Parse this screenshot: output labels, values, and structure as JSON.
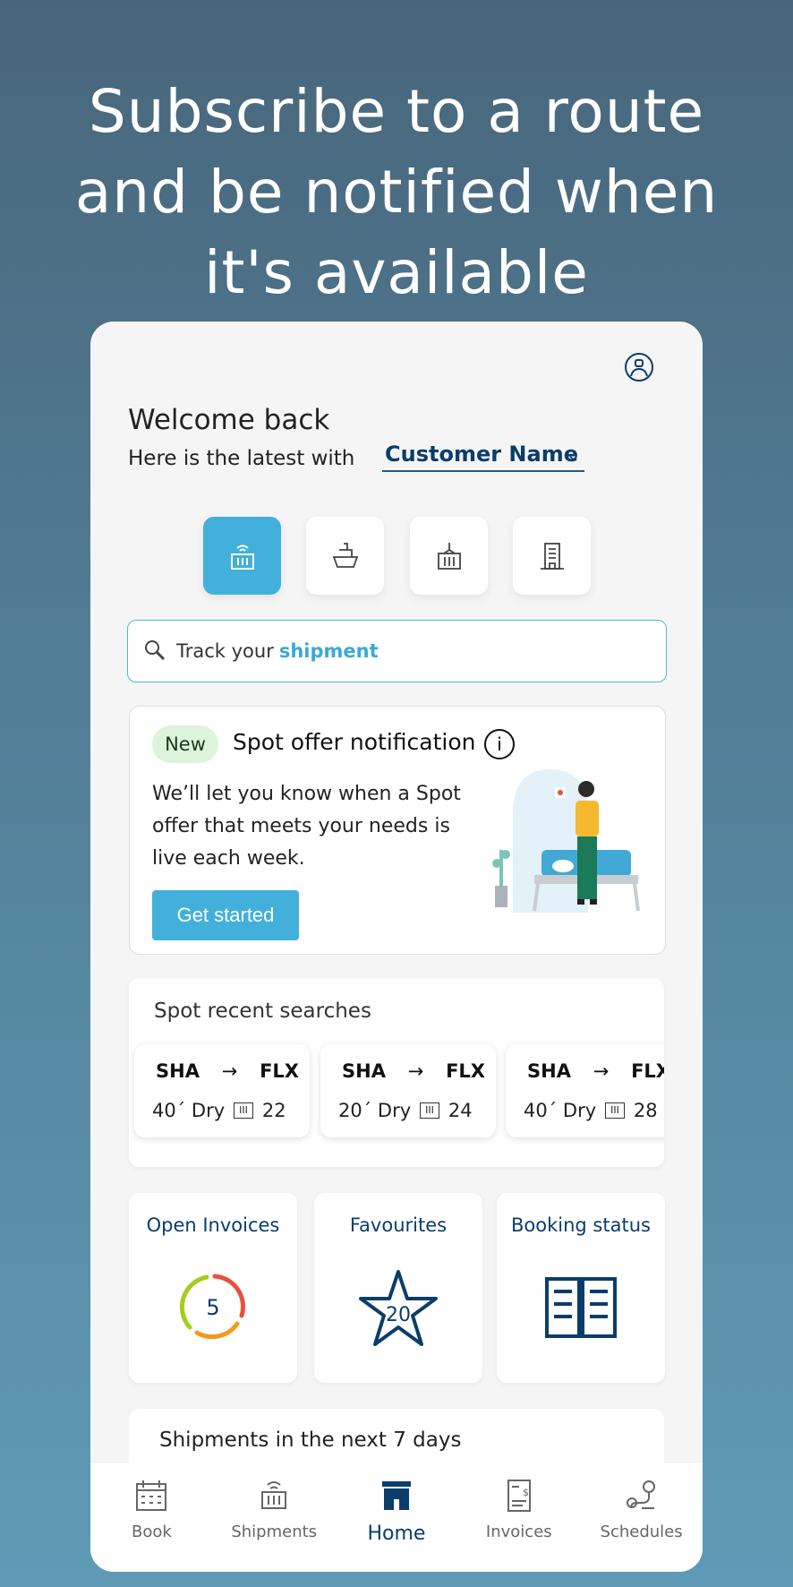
{
  "headline": [
    "Subscribe to a route",
    "and be notified when",
    "it's available"
  ],
  "header": {
    "welcome": "Welcome back",
    "subtitle": "Here is the latest with",
    "customer": "Customer Name",
    "chevron": "⌄"
  },
  "mode_tabs": [
    {
      "icon": "container-tracking-icon",
      "active": true
    },
    {
      "icon": "ship-icon",
      "active": false
    },
    {
      "icon": "container-crane-icon",
      "active": false
    },
    {
      "icon": "building-icon",
      "active": false
    }
  ],
  "search": {
    "prefix": "Track your",
    "highlight": "shipment"
  },
  "offer": {
    "badge": "New",
    "title": "Spot offer notification",
    "info": "i",
    "text": "We’ll let you know when a Spot offer that meets your needs is live each week.",
    "button": "Get started"
  },
  "recent": {
    "title": "Spot recent searches",
    "items": [
      {
        "from": "SHA",
        "to": "FLX",
        "container": "40´ Dry",
        "count": "22"
      },
      {
        "from": "SHA",
        "to": "FLX",
        "container": "20´ Dry",
        "count": "24"
      },
      {
        "from": "SHA",
        "to": "FLX",
        "container": "40´ Dry",
        "count": "28"
      }
    ]
  },
  "tiles": {
    "invoices": {
      "title": "Open Invoices",
      "count": "5"
    },
    "favourites": {
      "title": "Favourites",
      "count": "20"
    },
    "booking": {
      "title": "Booking status"
    }
  },
  "shipments": {
    "title": "Shipments in the next 7 days"
  },
  "nav": [
    {
      "label": "Book",
      "icon": "calendar-icon"
    },
    {
      "label": "Shipments",
      "icon": "container-icon"
    },
    {
      "label": "Home",
      "icon": "home-icon",
      "active": true
    },
    {
      "label": "Invoices",
      "icon": "invoice-icon"
    },
    {
      "label": "Schedules",
      "icon": "route-pin-icon"
    }
  ],
  "colors": {
    "accent": "#42b0da",
    "navy": "#0b3d6b",
    "card_bg": "#f5f5f5"
  }
}
